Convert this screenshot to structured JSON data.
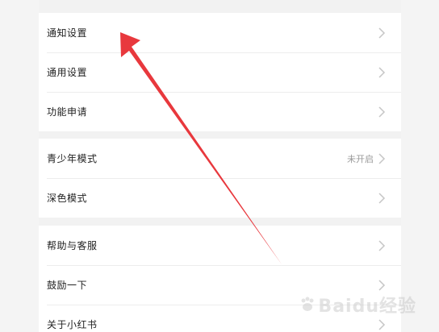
{
  "settings": {
    "group1": [
      {
        "label": "通知设置",
        "value": ""
      },
      {
        "label": "通用设置",
        "value": ""
      },
      {
        "label": "功能申请",
        "value": ""
      }
    ],
    "group2": [
      {
        "label": "青少年模式",
        "value": "未开启"
      },
      {
        "label": "深色模式",
        "value": ""
      }
    ],
    "group3": [
      {
        "label": "帮助与客服",
        "value": ""
      },
      {
        "label": "鼓励一下",
        "value": ""
      },
      {
        "label": "关于小红书",
        "value": ""
      }
    ]
  },
  "watermark": {
    "text": "Baidu经验"
  },
  "colors": {
    "annotation_arrow": "#e8383d",
    "row_background": "#ffffff",
    "page_background": "#f2f2f2"
  },
  "icons": {
    "row_chevron": "chevron-right-icon",
    "annotation": "red-arrow-icon",
    "watermark_logo": "baidu-paw-icon"
  }
}
